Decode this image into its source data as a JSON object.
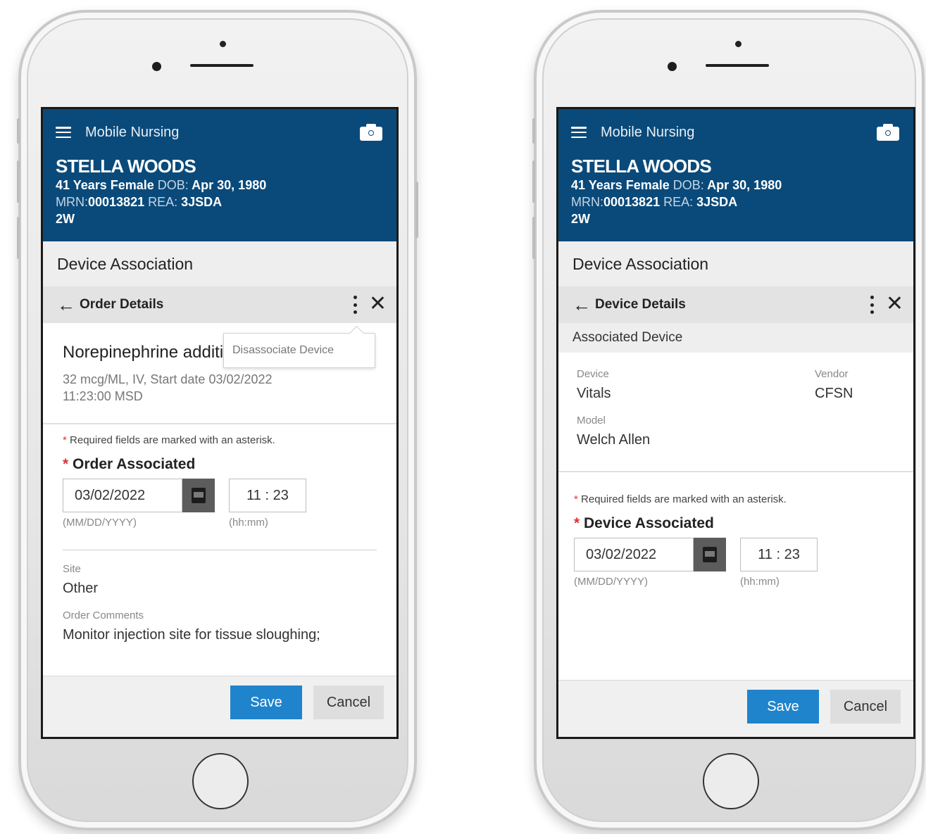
{
  "app": {
    "title": "Mobile Nursing"
  },
  "patient": {
    "name": "STELLA WOODS",
    "age_sex": "41 Years Female",
    "dob_label": "DOB:",
    "dob": "Apr 30, 1980",
    "mrn_label": "MRN:",
    "mrn": "00013821",
    "rea_label": "REA:",
    "rea": "3JSDA",
    "unit": "2W"
  },
  "page_title": "Device Association",
  "left_screen": {
    "subnav_title": "Order Details",
    "menu_popup": {
      "item": "Disassociate Device"
    },
    "order": {
      "name": "Norepinephrine additive",
      "desc_line1": "32 mcg/ML, IV, Start date 03/02/2022",
      "desc_line2": "11:23:00 MSD"
    },
    "required_note": "Required fields are marked with an asterisk.",
    "field_label": "Order Associated",
    "date_value": "03/02/2022",
    "date_hint": "(MM/DD/YYYY)",
    "time_value": "11 : 23",
    "time_hint": "(hh:mm)",
    "site_label": "Site",
    "site_value": "Other",
    "comments_label": "Order Comments",
    "comments_value": "Monitor injection site for tissue sloughing;"
  },
  "right_screen": {
    "subnav_title": "Device Details",
    "section_title": "Associated Device",
    "device_label": "Device",
    "device_value": "Vitals",
    "vendor_label": "Vendor",
    "vendor_value": "CFSN",
    "model_label": "Model",
    "model_value": "Welch Allen",
    "required_note": "Required fields are marked with an asterisk.",
    "field_label": "Device Associated",
    "date_value": "03/02/2022",
    "date_hint": "(MM/DD/YYYY)",
    "time_value": "11 : 23",
    "time_hint": "(hh:mm)"
  },
  "footer": {
    "save": "Save",
    "cancel": "Cancel"
  },
  "colors": {
    "header_bg": "#0a4a7a",
    "save_bg": "#1f84cc",
    "required": "#d33333"
  },
  "icons": [
    "menu-icon",
    "camera-icon",
    "back-arrow-icon",
    "kebab-icon",
    "close-icon",
    "calendar-icon"
  ]
}
